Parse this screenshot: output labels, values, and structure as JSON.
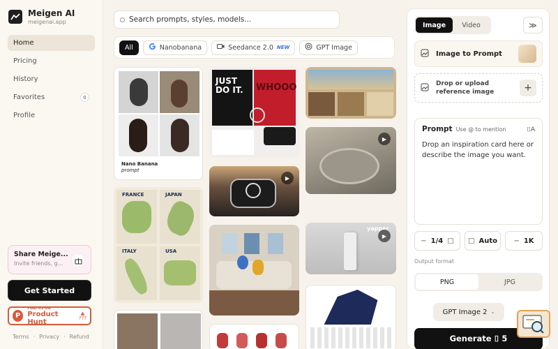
{
  "brand": {
    "title": "Meigen AI",
    "subtitle": "meigenai.app"
  },
  "nav": [
    {
      "label": "Home",
      "active": true
    },
    {
      "label": "Pricing"
    },
    {
      "label": "History"
    },
    {
      "label": "Favorites",
      "count": "0"
    },
    {
      "label": "Profile"
    }
  ],
  "share": {
    "title": "Share Meige...",
    "subtitle": "Invite friends, g..."
  },
  "get_started": "Get Started",
  "product_hunt": {
    "top": "FIND US ON",
    "name": "Product Hunt",
    "votes": "???"
  },
  "footer": [
    "Terms",
    "Privacy",
    "Refund"
  ],
  "search": {
    "placeholder": "Search prompts, styles, models..."
  },
  "filters": [
    {
      "label": "All",
      "active": true
    },
    {
      "label": "Nanobanana",
      "icon": "google-icon"
    },
    {
      "label": "Seedance 2.0",
      "icon": "video-icon",
      "badge": "NEW"
    },
    {
      "label": "GPT Image",
      "icon": "openai-icon"
    }
  ],
  "gallery": {
    "nano_title": "Nano Banana",
    "nano_sub": "prompt",
    "poster_text": "JUST DO IT.",
    "poster_text2": "WHOOO",
    "map_labels": [
      "FRANCE",
      "JAPAN",
      "ITALY",
      "USA"
    ],
    "watermark": "yapper"
  },
  "panel": {
    "modes": [
      "Image",
      "Video"
    ],
    "image_to_prompt": "Image to Prompt",
    "upload": "Drop or upload reference image",
    "prompt_title": "Prompt",
    "prompt_hint": "Use @ to mention",
    "prompt_tool": "⌷A",
    "prompt_placeholder": "Drop an inspiration card here or describe the image you want.",
    "count": "1/4",
    "ratio": "Auto",
    "resolution": "1K",
    "output_label": "Output format",
    "formats": [
      "PNG",
      "JPG"
    ],
    "model": "GPT Image 2",
    "generate": "Generate ⌷ 5"
  }
}
